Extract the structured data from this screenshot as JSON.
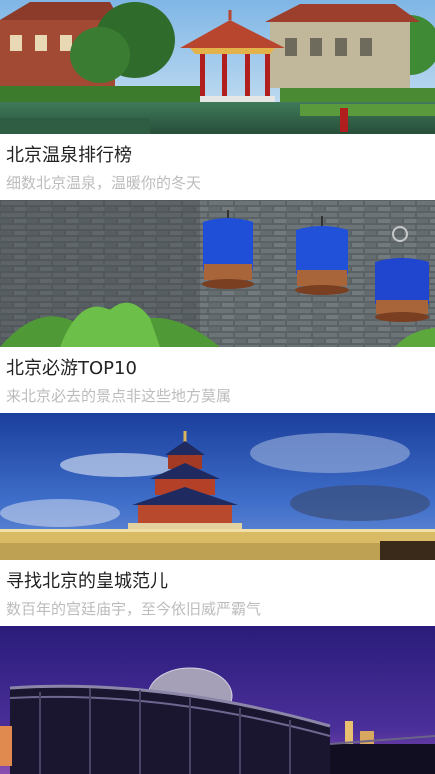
{
  "cards": [
    {
      "title": "北京温泉排行榜",
      "subtitle": "细数北京温泉，温暖你的冬天",
      "image": "hot-spring-pavilion-photo"
    },
    {
      "title": "北京必游TOP10",
      "subtitle": "来北京必去的景点非这些地方莫属",
      "image": "birdcages-on-brick-wall-photo"
    },
    {
      "title": "寻找北京的皇城范儿",
      "subtitle": "数百年的宫廷庙宇，至今依旧威严霸气",
      "image": "temple-of-heaven-photo"
    },
    {
      "title": "",
      "subtitle": "",
      "image": "national-theatre-night-photo"
    }
  ]
}
